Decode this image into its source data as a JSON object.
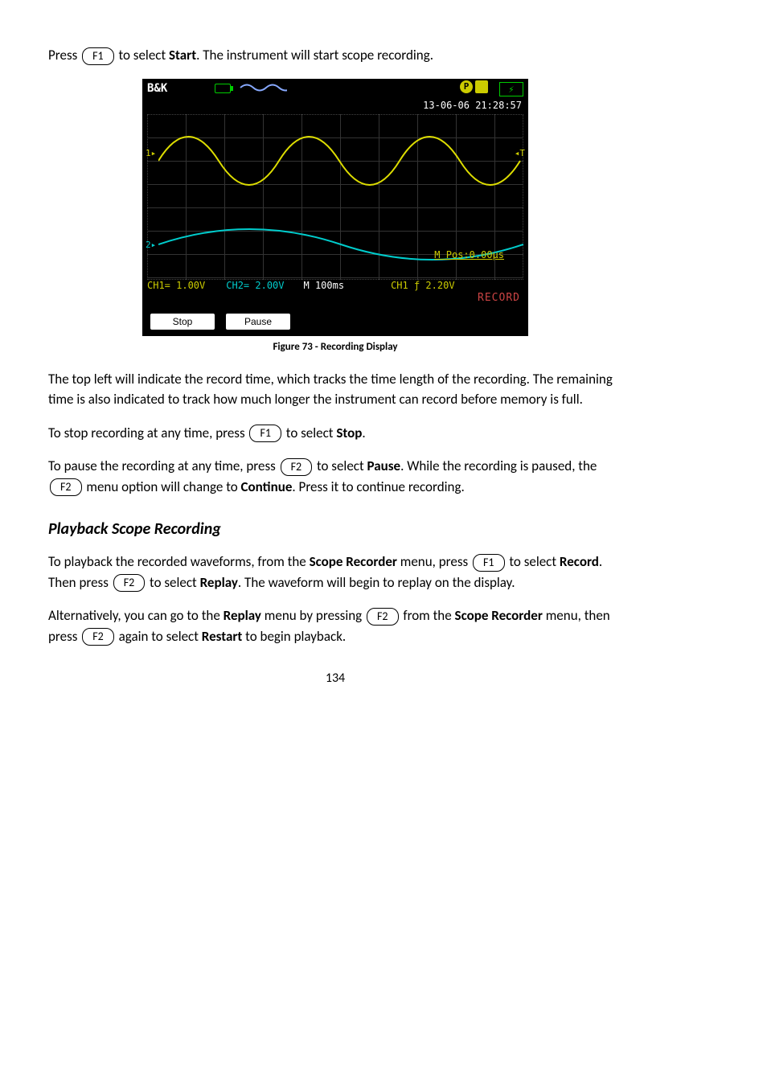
{
  "intro": {
    "prefix": "Press ",
    "key": "F1",
    "suffix1": " to select ",
    "bold1": "Start",
    "suffix2": ".  The instrument will start scope recording."
  },
  "scope": {
    "brand": "B&K",
    "datetime": "13-06-06 21:28:57",
    "ch1_marker": "1",
    "ch2_marker": "2",
    "tmarker": "T",
    "mpos": "M Pos:0.00μs",
    "ch1": "CH1= 1.00V",
    "ch2": "CH2= 2.00V",
    "mtime": "M 100ms",
    "trig": "CH1 ƒ 2.20V",
    "record": "RECORD",
    "btn_stop": "Stop",
    "btn_pause": "Pause",
    "p_icon": "P",
    "bolt": "⚡"
  },
  "figcap": "Figure 73 - Recording Display",
  "para2": "The top left will indicate the record time, which tracks the time length of the recording.  The remaining time is also indicated to track how much longer the instrument can record before memory is full.",
  "stop_line": {
    "t1": "To stop recording at any time, press ",
    "key": "F1",
    "t2": " to select ",
    "bold": "Stop",
    "t3": "."
  },
  "pause_block": {
    "l1a": "To pause the recording at any time, press ",
    "k1": "F2",
    "l1b": " to select ",
    "b1": "Pause",
    "l1c": ".  While the recording is paused, the ",
    "k2": "F2",
    "l1d": " menu option will change to ",
    "b2": "Continue",
    "l1e": ".  Press it to continue recording."
  },
  "section": "Playback Scope Recording",
  "playback1": {
    "t1": "To playback the recorded waveforms, from the ",
    "b1": "Scope Recorder",
    "t2": " menu, press ",
    "k1": "F1",
    "t3": " to select ",
    "b2": "Record",
    "t4": ".  Then press ",
    "k2": "F2",
    "t5": " to select ",
    "b3": "Replay",
    "t6": ".  The waveform will begin to replay on the display."
  },
  "playback2": {
    "t1": "Alternatively, you can go to the ",
    "b1": "Replay",
    "t2": " menu by pressing ",
    "k1": "F2",
    "t3": " from the ",
    "b2": "Scope Recorder",
    "t4": " menu, then press ",
    "k2": "F2",
    "t5": " again to select ",
    "b3": "Restart",
    "t6": " to begin playback."
  },
  "page": "134"
}
